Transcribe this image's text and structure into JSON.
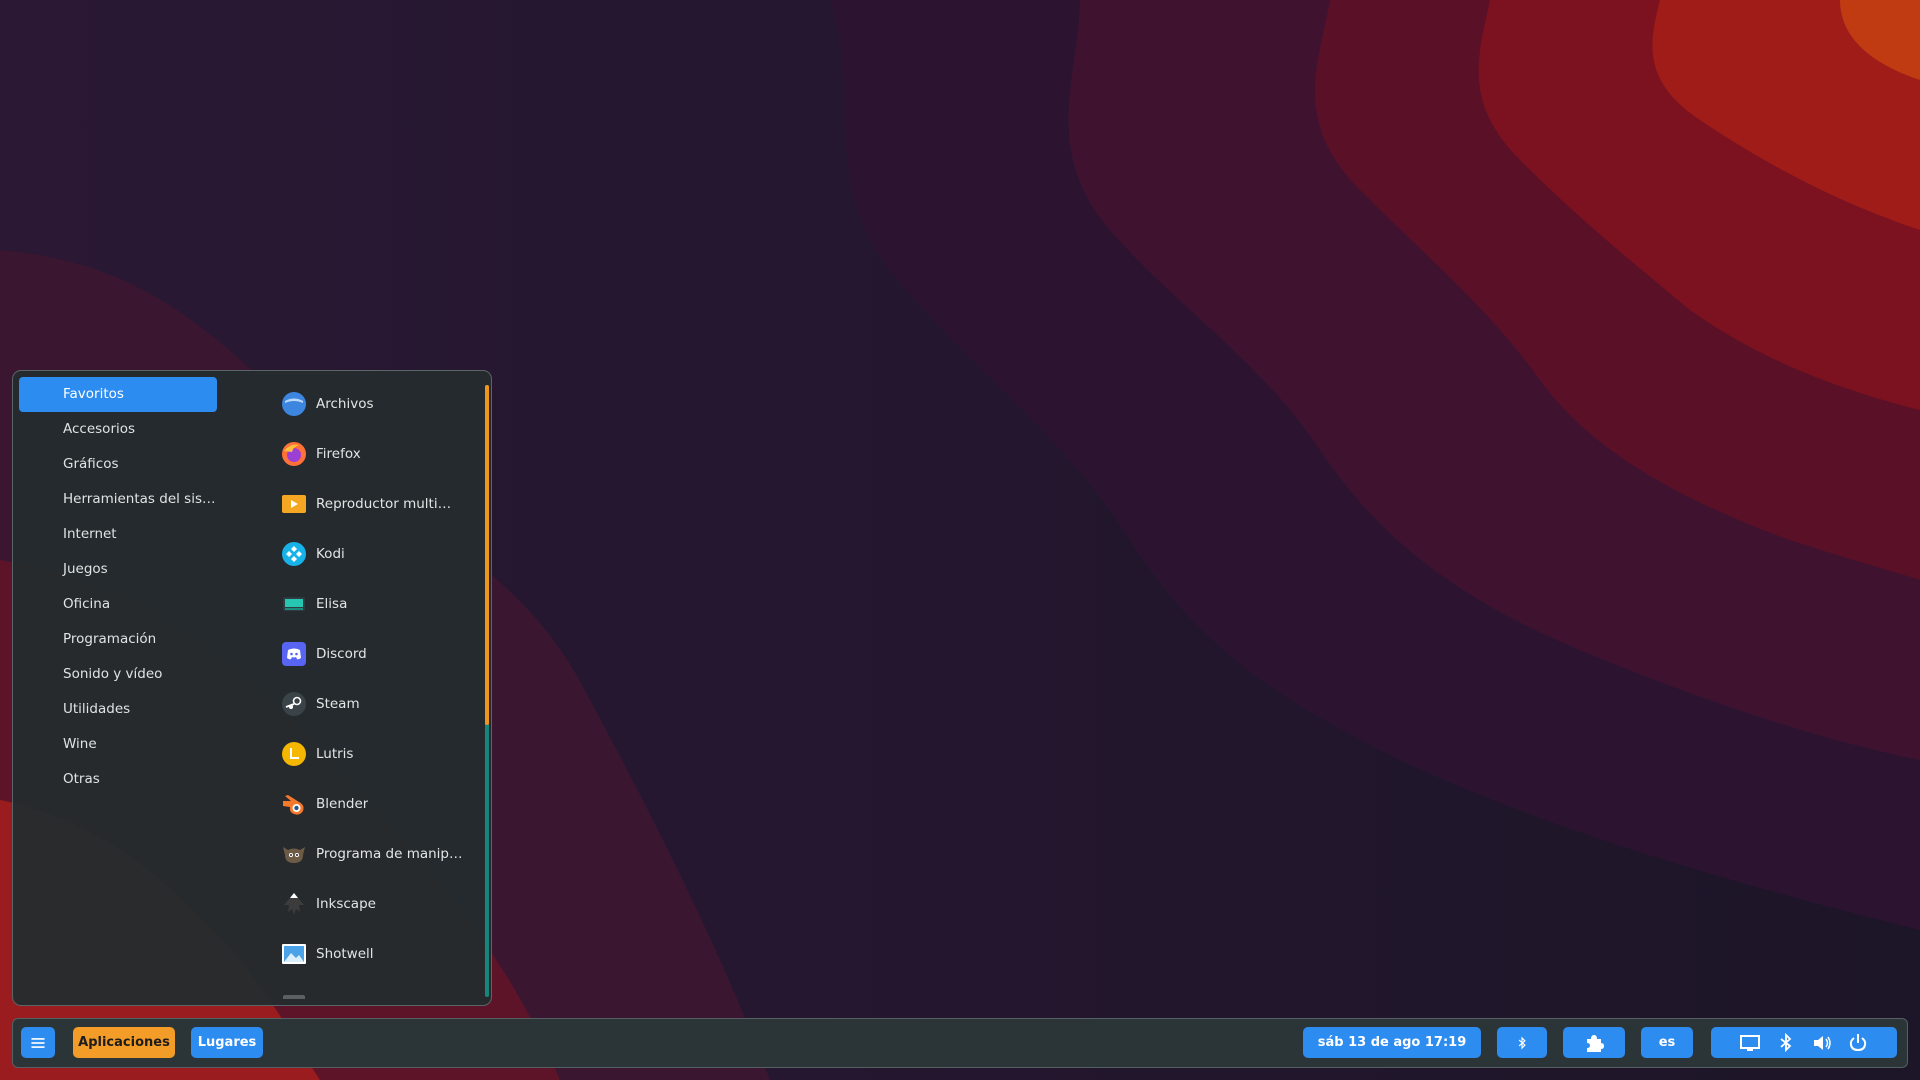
{
  "menu": {
    "categories": [
      {
        "label": "Favoritos",
        "active": true
      },
      {
        "label": "Accesorios"
      },
      {
        "label": "Gráficos"
      },
      {
        "label": "Herramientas del sis…"
      },
      {
        "label": "Internet"
      },
      {
        "label": "Juegos"
      },
      {
        "label": "Oficina"
      },
      {
        "label": "Programación"
      },
      {
        "label": "Sonido y vídeo"
      },
      {
        "label": "Utilidades"
      },
      {
        "label": "Wine"
      },
      {
        "label": "Otras"
      }
    ],
    "apps": [
      {
        "label": "Archivos",
        "icon": "files-icon"
      },
      {
        "label": "Firefox",
        "icon": "firefox-icon"
      },
      {
        "label": "Reproductor multi…",
        "icon": "media-player-icon"
      },
      {
        "label": "Kodi",
        "icon": "kodi-icon"
      },
      {
        "label": "Elisa",
        "icon": "elisa-icon"
      },
      {
        "label": "Discord",
        "icon": "discord-icon"
      },
      {
        "label": "Steam",
        "icon": "steam-icon"
      },
      {
        "label": "Lutris",
        "icon": "lutris-icon"
      },
      {
        "label": "Blender",
        "icon": "blender-icon"
      },
      {
        "label": "Programa de manip…",
        "icon": "gimp-icon"
      },
      {
        "label": "Inkscape",
        "icon": "inkscape-icon"
      },
      {
        "label": "Shotwell",
        "icon": "shotwell-icon"
      }
    ]
  },
  "panel": {
    "menu_icon": "hamburger-icon",
    "applications_label": "Aplicaciones",
    "places_label": "Lugares",
    "datetime": "sáb 13 de ago  17:19",
    "keyboard_layout": "es",
    "tray_icons": [
      "bluetooth-icon",
      "extensions-icon",
      "display-icon",
      "bluetooth-icon",
      "volume-icon",
      "power-icon"
    ]
  },
  "colors": {
    "accent_blue": "#2d8cf0",
    "accent_orange": "#f39c27",
    "menu_background": "#242c2e",
    "panel_background": "#2b3436",
    "scroll_track": "#16867d"
  }
}
